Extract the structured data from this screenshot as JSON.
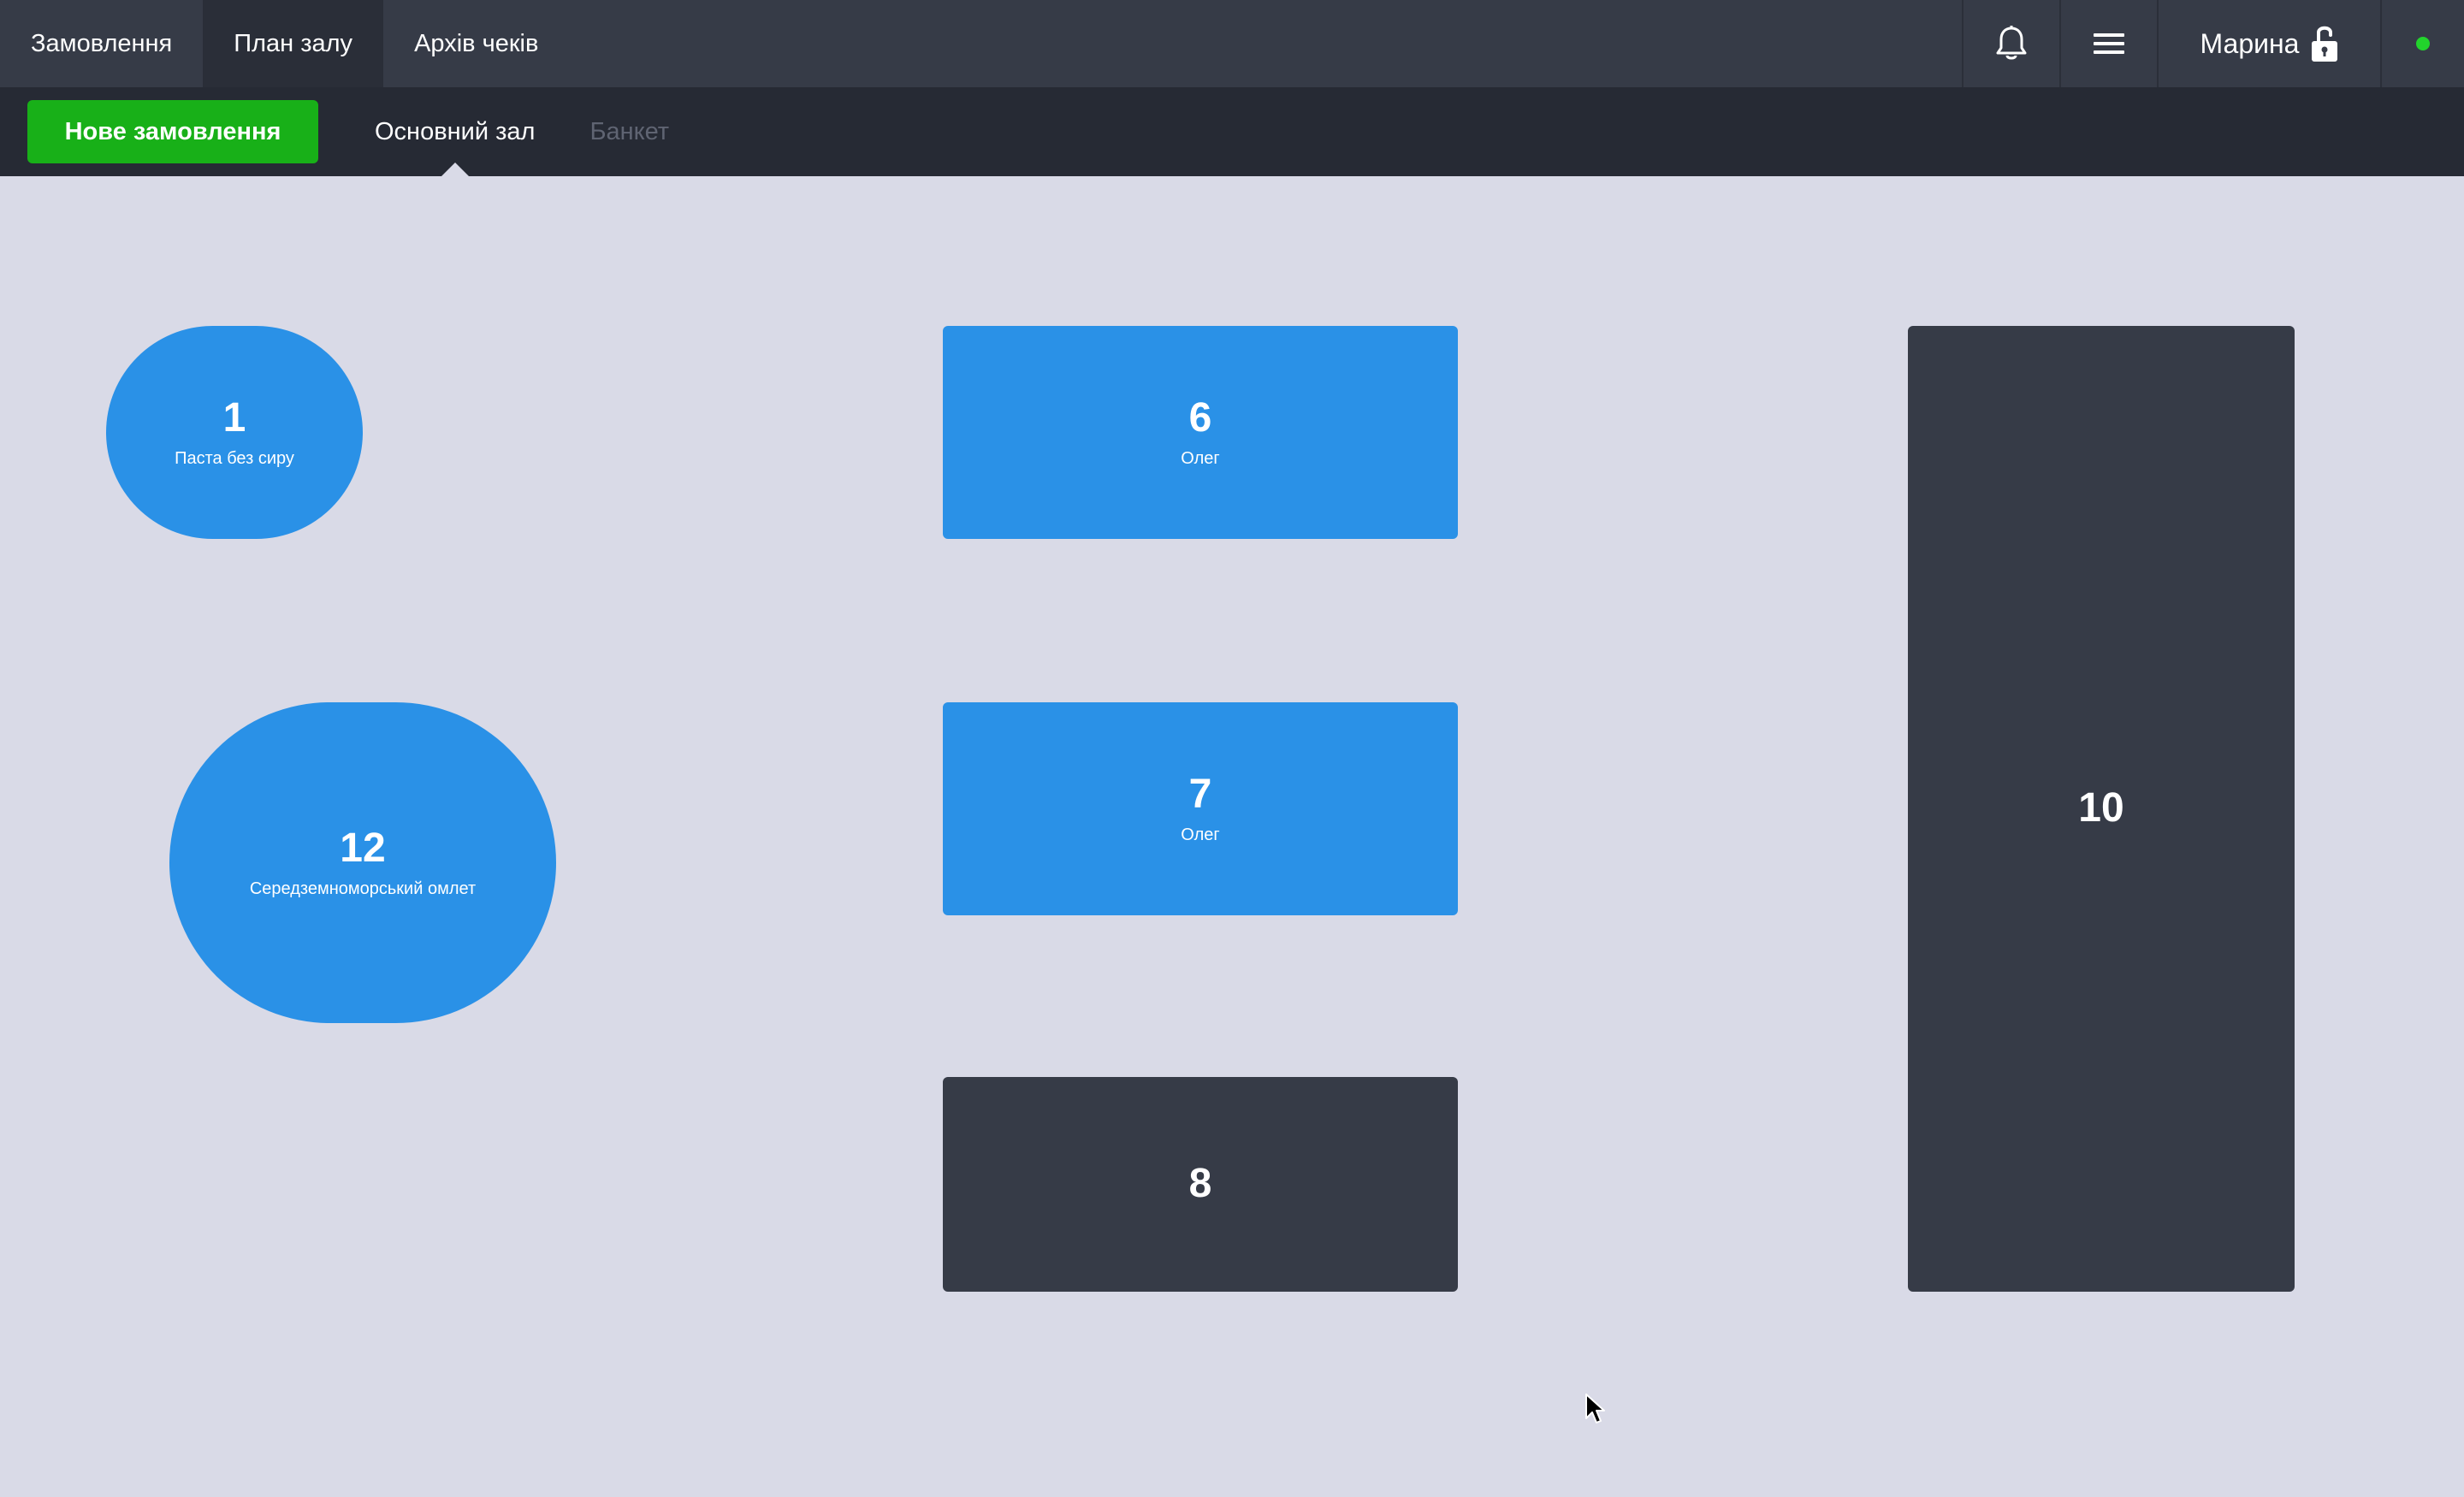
{
  "nav": {
    "tabs": [
      {
        "label": "Замовлення",
        "active": false
      },
      {
        "label": "План залу",
        "active": true
      },
      {
        "label": "Архів чеків",
        "active": false
      }
    ],
    "notifications_icon": "bell-icon",
    "menu_icon": "hamburger-menu-icon",
    "user": {
      "name": "Марина",
      "lock_icon": "unlock-icon"
    },
    "status_color": "#22d42c"
  },
  "subbar": {
    "new_order_label": "Нове замовлення",
    "halls": [
      {
        "label": "Основний зал",
        "active": true
      },
      {
        "label": "Банкет",
        "active": false
      }
    ]
  },
  "tables": [
    {
      "number": "1",
      "note": "Паста без сиру",
      "status": "busy"
    },
    {
      "number": "12",
      "note": "Середземноморський омлет",
      "status": "busy"
    },
    {
      "number": "6",
      "note": "Олег",
      "status": "busy"
    },
    {
      "number": "7",
      "note": "Олег",
      "status": "busy"
    },
    {
      "number": "8",
      "note": "",
      "status": "free"
    },
    {
      "number": "10",
      "note": "",
      "status": "free"
    }
  ],
  "colors": {
    "busy_table": "#2a91e7",
    "free_table": "#363b47",
    "accent_green": "#18b018",
    "floor_bg": "#d9dae7"
  }
}
